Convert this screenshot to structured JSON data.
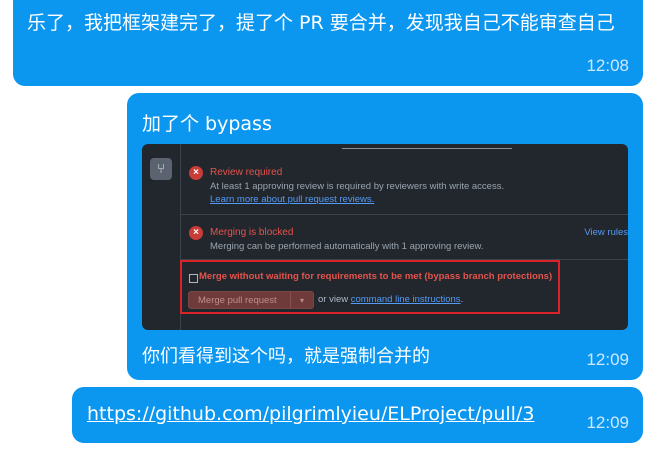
{
  "messages": [
    {
      "text": "乐了，我把框架建完了，提了个 PR 要合并，发现我自己不能审查自己",
      "time": "12:08"
    },
    {
      "caption": "加了个 bypass",
      "footer": "你们看得到这个吗，就是强制合并的",
      "time": "12:09",
      "screenshot": {
        "review_title": "Review required",
        "review_desc": "At least 1 approving review is required by reviewers with write access.",
        "review_link": "Learn more about pull request reviews.",
        "blocked_title": "Merging is blocked",
        "blocked_desc": "Merging can be performed automatically with 1 approving review.",
        "view_rules": "View rules",
        "bypass_label": "Merge without waiting for requirements to be met (bypass branch protections)",
        "merge_button": "Merge pull request",
        "or_view": "or view",
        "cli_link": "command line instructions",
        "period": "."
      }
    },
    {
      "link": "https://github.com/pilgrimlyieu/ELProject/pull/3",
      "time": "12:09"
    }
  ],
  "colors": {
    "bubble": "#0b96f0",
    "screenshot_bg": "#22272e",
    "error_red": "#e5534b",
    "link_blue": "#539bf5",
    "highlight_border": "#d9222a"
  },
  "icons": {
    "merge": "git-merge-icon",
    "error": "x-circle-icon",
    "caret": "caret-down-icon"
  }
}
